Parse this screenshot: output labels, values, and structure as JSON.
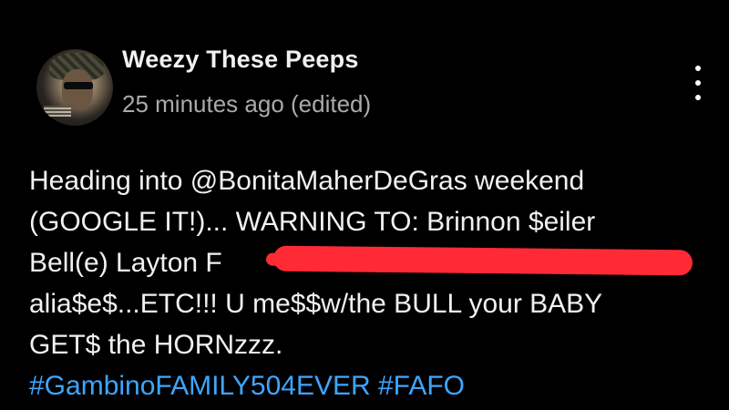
{
  "comment": {
    "author": "Weezy These Peeps",
    "timestamp": "25 minutes ago (edited)",
    "lines": [
      "Heading into @BonitaMaherDeGras weekend",
      "(GOOGLE IT!)... WARNING TO: Brinnon $eiler",
      "Bell(e) Layton F",
      "alia$e$...ETC!!! U me$$w/the BULL your BABY",
      "GET$ the HORNzzz."
    ],
    "hashtags": "#GambinoFAMILY504EVER #FAFO"
  },
  "icons": {
    "avatar": "user-avatar",
    "more": "more-vert-icon"
  },
  "colors": {
    "background": "#000000",
    "text": "#f1f1f1",
    "secondary_text": "#aaaaaa",
    "hashtag": "#3ea6ff",
    "redaction": "#ff2a35"
  }
}
